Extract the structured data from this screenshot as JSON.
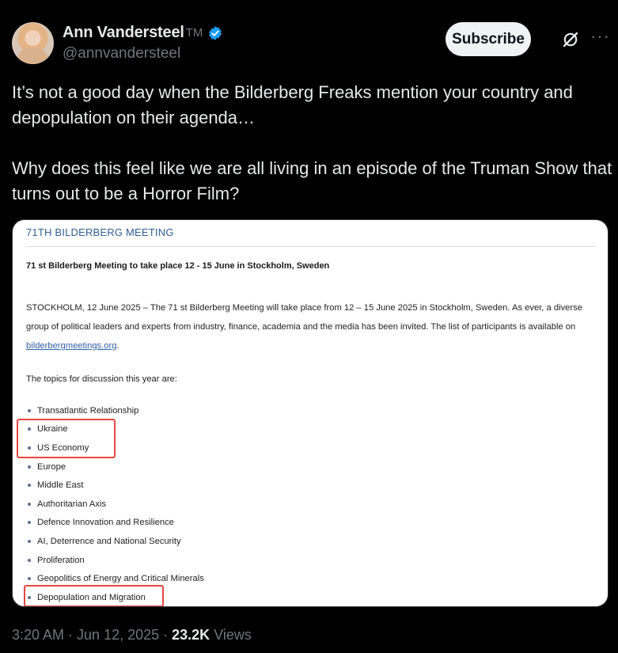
{
  "author": {
    "display_name": "Ann Vandersteel",
    "tm": "TM",
    "handle": "@annvandersteel",
    "verified_icon": "verified-badge-icon"
  },
  "actions": {
    "subscribe_label": "Subscribe",
    "grok_icon": "grok-icon",
    "more_label": "···"
  },
  "tweet": {
    "text": "It’s not a good day when the Bilderberg Freaks mention your country and depopulation on their agenda…\n\nWhy does this feel like we are all living in an episode of the Truman Show that turns out to be a Horror Film?"
  },
  "document": {
    "title": "71TH BILDERBERG MEETING",
    "heading": "71 st Bilderberg Meeting to take place 12 - 15 June in Stockholm, Sweden",
    "paragraph_pre": "STOCKHOLM, 12 June 2025 – The 71 st Bilderberg Meeting will take place from 12 – 15 June 2025 in Stockholm, Sweden. As ever, a diverse group of political leaders and experts from industry, finance, academia and the media has been invited. The list of participants is available on ",
    "paragraph_link": "bilderbergmeetings.org",
    "paragraph_post": ".",
    "topics_title": "The topics for discussion this year are:",
    "topics": [
      "Transatlantic Relationship",
      "Ukraine",
      "US Economy",
      "Europe",
      "Middle East",
      "Authoritarian Axis",
      "Defence Innovation and Resilience",
      "AI, Deterrence and National Security",
      "Proliferation",
      "Geopolitics of Energy and Critical Minerals",
      "Depopulation and Migration"
    ],
    "highlighted_topics": [
      "Ukraine",
      "US Economy",
      "Depopulation and Migration"
    ],
    "highlight_color": "#e4473f"
  },
  "meta": {
    "time": "3:20 AM",
    "date": "Jun 12, 2025",
    "views_count": "23.2K",
    "views_label": "Views"
  },
  "colors": {
    "background": "#000000",
    "primary_text": "#e7e9ea",
    "secondary_text": "#71767b",
    "verified_blue": "#1d9bf0"
  }
}
